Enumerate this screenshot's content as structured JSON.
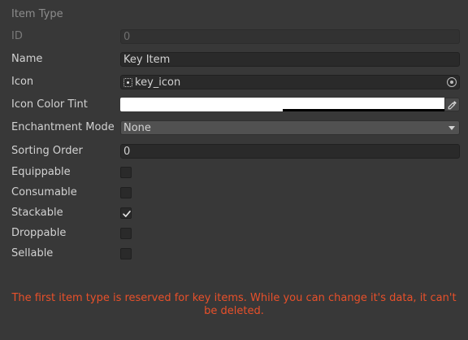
{
  "header": {
    "title": "Item Type"
  },
  "fields": {
    "id": {
      "label": "ID",
      "value": "0"
    },
    "name": {
      "label": "Name",
      "value": "Key Item"
    },
    "icon": {
      "label": "Icon",
      "value": "key_icon",
      "icon_name": "sprite-icon"
    },
    "icon_color_tint": {
      "label": "Icon Color Tint",
      "color": "#ffffff",
      "icon_name": "eyedropper-icon"
    },
    "enchantment_mode": {
      "label": "Enchantment Mode",
      "selected": "None"
    },
    "sorting_order": {
      "label": "Sorting Order",
      "value": "0"
    }
  },
  "flags": [
    {
      "key": "equippable",
      "label": "Equippable",
      "checked": false
    },
    {
      "key": "consumable",
      "label": "Consumable",
      "checked": false
    },
    {
      "key": "stackable",
      "label": "Stackable",
      "checked": true
    },
    {
      "key": "droppable",
      "label": "Droppable",
      "checked": false
    },
    {
      "key": "sellable",
      "label": "Sellable",
      "checked": false
    }
  ],
  "warning": {
    "text": "The first item type is reserved for key items. While you can change it's data, it can't be deleted.",
    "color": "#e8502a"
  }
}
